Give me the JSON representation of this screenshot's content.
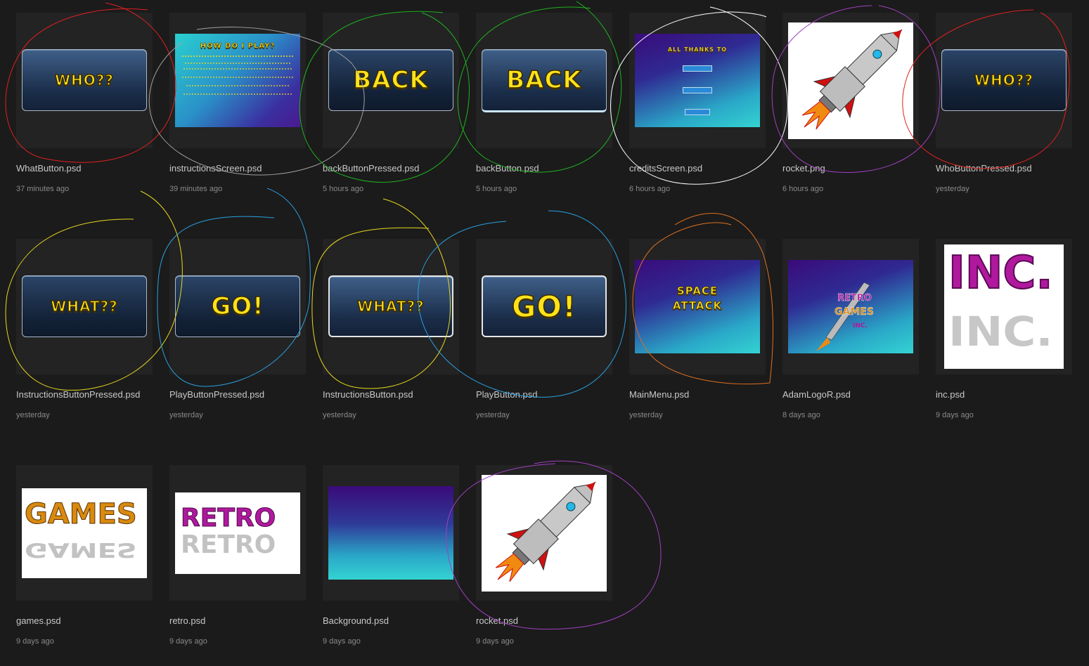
{
  "files": [
    {
      "name": "WhatButton.psd",
      "time": "37 minutes ago",
      "art": "btn",
      "label": "WHO??"
    },
    {
      "name": "instructionsScreen.psd",
      "time": "39 minutes ago",
      "art": "screen",
      "label": "HOW DO I PLAY?"
    },
    {
      "name": "backButtonPressed.psd",
      "time": "5 hours ago",
      "art": "btn-pressed",
      "label": "BACK"
    },
    {
      "name": "backButton.psd",
      "time": "5 hours ago",
      "art": "btn-lit",
      "label": "BACK"
    },
    {
      "name": "creditsScreen.psd",
      "time": "6 hours ago",
      "art": "credits",
      "label": "ALL THANKS TO"
    },
    {
      "name": "rocket.png",
      "time": "6 hours ago",
      "art": "rocket",
      "label": ""
    },
    {
      "name": "WhoButtonPressed.psd",
      "time": "yesterday",
      "art": "btn-pressed",
      "label": "WHO??"
    },
    {
      "name": "InstructionsButtonPressed.psd",
      "time": "yesterday",
      "art": "btn-pressed",
      "label": "WHAT??"
    },
    {
      "name": "PlayButtonPressed.psd",
      "time": "yesterday",
      "art": "btn-pressed",
      "label": "GO!"
    },
    {
      "name": "InstructionsButton.psd",
      "time": "yesterday",
      "art": "btn-white",
      "label": "WHAT??"
    },
    {
      "name": "PlayButton.psd",
      "time": "yesterday",
      "art": "btn-white",
      "label": "GO!"
    },
    {
      "name": "MainMenu.psd",
      "time": "yesterday",
      "art": "mainmenu",
      "label": "SPACE ATTACK"
    },
    {
      "name": "AdamLogoR.psd",
      "time": "8 days ago",
      "art": "logo",
      "label": "RETRO GAMES INC."
    },
    {
      "name": "inc.psd",
      "time": "9 days ago",
      "art": "inc",
      "label": "INC."
    },
    {
      "name": "games.psd",
      "time": "9 days ago",
      "art": "games",
      "label": "GAMES"
    },
    {
      "name": "retro.psd",
      "time": "9 days ago",
      "art": "retro",
      "label": "RETRO"
    },
    {
      "name": "Background.psd",
      "time": "9 days ago",
      "art": "background",
      "label": ""
    },
    {
      "name": "rocket.psd",
      "time": "9 days ago",
      "art": "rocket",
      "label": ""
    }
  ],
  "screen_text": {
    "instructions_title": "HOW DO I PLAY?",
    "credits_title": "ALL THANKS TO"
  },
  "colors": {
    "background": "#1b1b1b",
    "card": "#232323",
    "button_text": "#ffe21a",
    "gradient_top": "#3a0b7a",
    "gradient_bottom": "#33d3d3",
    "magenta": "#b0189e",
    "gold": "#d88a10"
  }
}
